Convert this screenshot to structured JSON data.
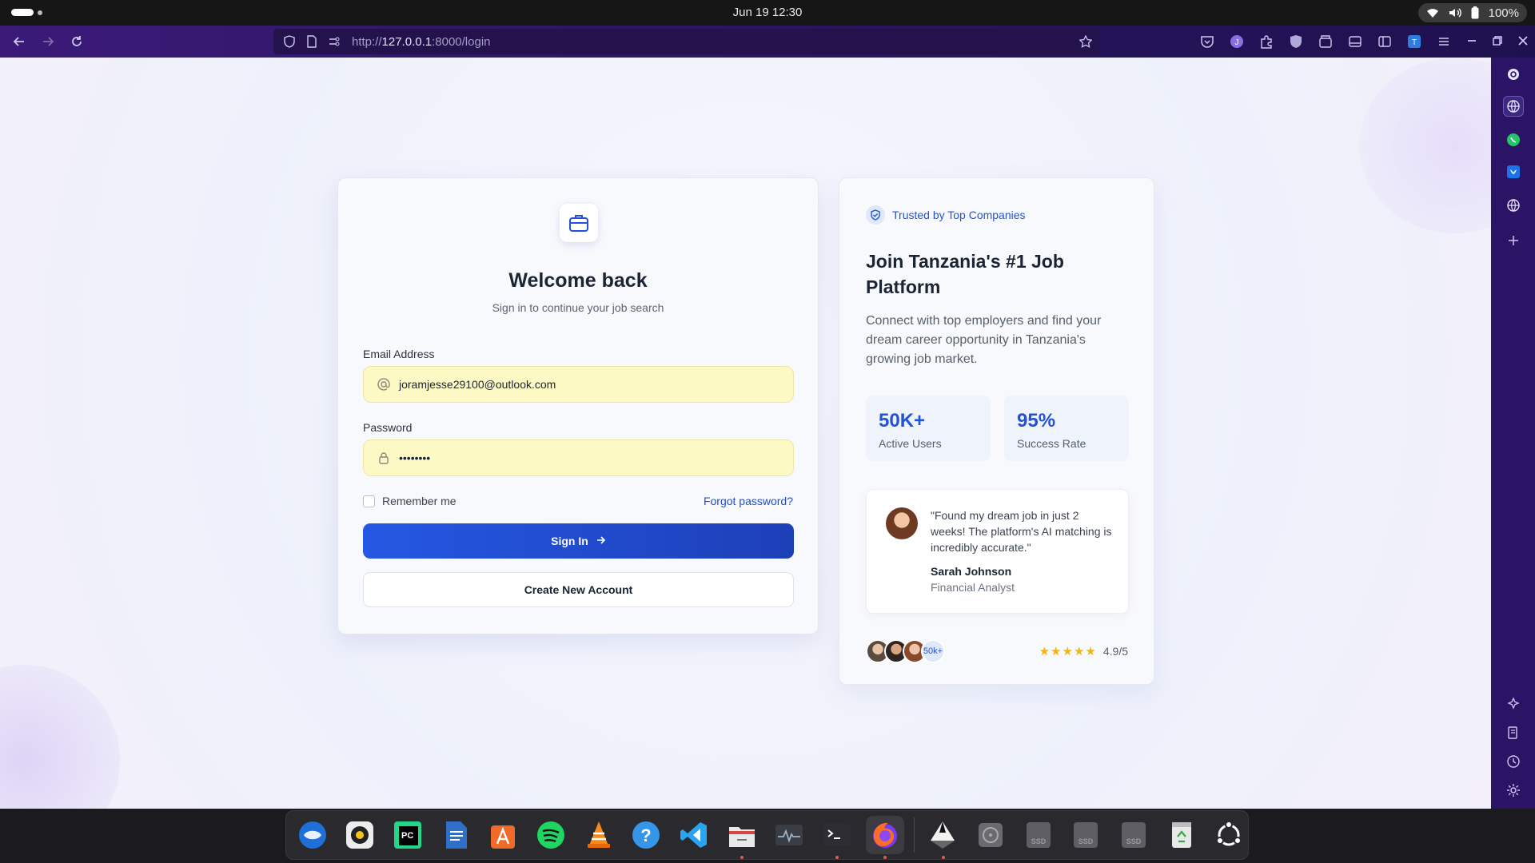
{
  "os": {
    "clock": "Jun 19  12:30",
    "battery": "100%"
  },
  "browser": {
    "url_prefix": "http://",
    "url_host": "127.0.0.1",
    "url_rest": ":8000/login"
  },
  "login": {
    "title": "Welcome back",
    "subtitle": "Sign in to continue your job search",
    "email_label": "Email Address",
    "email_value": "joramjesse29100@outlook.com",
    "password_label": "Password",
    "password_value": "••••••••",
    "remember_label": "Remember me",
    "forgot_label": "Forgot password?",
    "signin_label": "Sign In",
    "create_label": "Create New Account"
  },
  "info": {
    "badge": "Trusted by Top Companies",
    "heading": "Join Tanzania's #1 Job Platform",
    "description": "Connect with top employers and find your dream career opportunity in Tanzania's growing job market.",
    "stats": [
      {
        "value": "50K+",
        "label": "Active Users"
      },
      {
        "value": "95%",
        "label": "Success Rate"
      }
    ],
    "testimonial": {
      "quote": "\"Found my dream job in just 2 weeks! The platform's AI matching is incredibly accurate.\"",
      "name": "Sarah Johnson",
      "role": "Financial Analyst"
    },
    "avatars_more": "50k+",
    "stars": "★★★★★",
    "rating": "4.9/5"
  },
  "colors": {
    "accent": "#2352d6",
    "browser_bar": "#2a1560",
    "field_autofill": "#fdf9c4"
  },
  "dock": {
    "apps": [
      "thunderbird-icon",
      "rhythmbox-icon",
      "pycharm-icon",
      "writer-icon",
      "app-center-icon",
      "spotify-icon",
      "vlc-icon",
      "help-icon",
      "vscode-icon",
      "files-icon",
      "system-monitor-icon",
      "terminal-icon",
      "firefox-icon",
      "inkscape-icon",
      "disk-icon",
      "ssd-icon",
      "ssd-icon",
      "ssd-icon",
      "trash-icon",
      "ubuntu-icon"
    ],
    "ssd_label": "SSD",
    "pc_label": "PC"
  }
}
